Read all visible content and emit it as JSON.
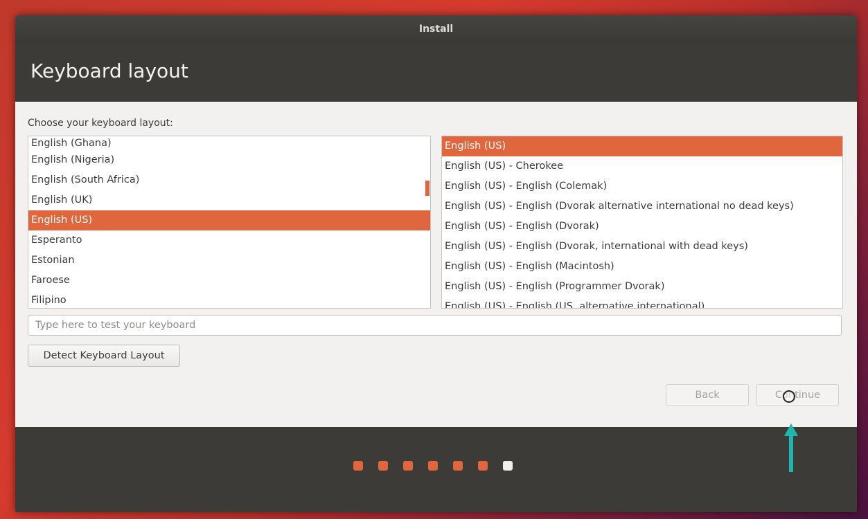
{
  "window": {
    "title": "Install",
    "page_title": "Keyboard layout"
  },
  "prompt": "Choose your keyboard layout:",
  "layouts": [
    {
      "label": "English (Ghana)",
      "selected": false
    },
    {
      "label": "English (Nigeria)",
      "selected": false
    },
    {
      "label": "English (South Africa)",
      "selected": false
    },
    {
      "label": "English (UK)",
      "selected": false
    },
    {
      "label": "English (US)",
      "selected": true
    },
    {
      "label": "Esperanto",
      "selected": false
    },
    {
      "label": "Estonian",
      "selected": false
    },
    {
      "label": "Faroese",
      "selected": false
    },
    {
      "label": "Filipino",
      "selected": false
    }
  ],
  "variants": [
    {
      "label": "English (US)",
      "selected": true
    },
    {
      "label": "English (US) - Cherokee",
      "selected": false
    },
    {
      "label": "English (US) - English (Colemak)",
      "selected": false
    },
    {
      "label": "English (US) - English (Dvorak alternative international no dead keys)",
      "selected": false
    },
    {
      "label": "English (US) - English (Dvorak)",
      "selected": false
    },
    {
      "label": "English (US) - English (Dvorak, international with dead keys)",
      "selected": false
    },
    {
      "label": "English (US) - English (Macintosh)",
      "selected": false
    },
    {
      "label": "English (US) - English (Programmer Dvorak)",
      "selected": false
    },
    {
      "label": "English (US) - English (US, alternative international)",
      "selected": false
    }
  ],
  "test_input": {
    "placeholder": "Type here to test your keyboard",
    "value": ""
  },
  "buttons": {
    "detect": "Detect Keyboard Layout",
    "back": "Back",
    "continue": "Continue"
  },
  "progress": {
    "total_steps": 7,
    "current_step": 7
  },
  "colors": {
    "accent": "#e0663e",
    "header": "#3c3b37",
    "content_bg": "#f2f1f0"
  }
}
